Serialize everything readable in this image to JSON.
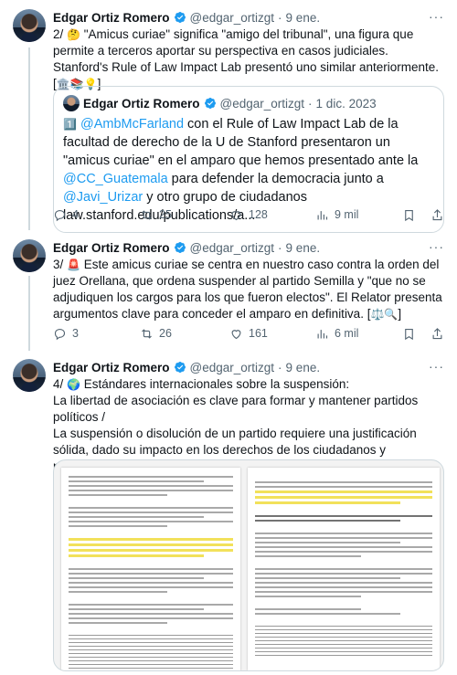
{
  "tweets": [
    {
      "author": "Edgar Ortiz Romero",
      "handle": "@edgar_ortizgt",
      "dot": "·",
      "date": "9 ene.",
      "more": "···",
      "text_prefix": "2/ ",
      "emoji_lead": "🤔",
      "text_body": " \"Amicus curiae\" significa \"amigo del tribunal\", una figura que permite a terceros aportar su perspectiva en casos judiciales. Stanford's Rule of Law Impact Lab presentó uno similar anteriormente. [",
      "emoji_trail": "🏛️📚💡",
      "text_close": "]",
      "quote": {
        "author": "Edgar Ortiz Romero",
        "handle": "@edgar_ortizgt",
        "dot": "·",
        "date": "1 dic. 2023",
        "emoji": "1️⃣",
        "mention1": "@AmbMcFarland",
        "t1": " con el Rule of Law Impact Lab de la facultad de derecho de la U de Stanford presentaron un \"amicus curiae\" en el amparo que hemos presentado ante la ",
        "mention2": "@CC_Guatemala",
        "t2": " para defender la democracia junto a ",
        "mention3": "@Javi_Urizar",
        "t3": " y otro grupo de ciudadanos law.stanford.edu/publications/a..."
      },
      "replies": "4",
      "retweets": "25",
      "likes": "128",
      "views": "9 mil"
    },
    {
      "author": "Edgar Ortiz Romero",
      "handle": "@edgar_ortizgt",
      "dot": "·",
      "date": "9 ene.",
      "more": "···",
      "text_prefix": "3/ ",
      "emoji_lead": "🚨",
      "text_body": " Este amicus curiae se centra en nuestro caso contra la orden del juez Orellana, que ordena suspender al partido Semilla y \"que no se adjudiquen los cargos para los que fueron electos\". El Relator presenta argumentos clave para conceder el amparo en definitiva. [",
      "emoji_trail": "⚖️🔍",
      "text_close": "]",
      "replies": "3",
      "retweets": "26",
      "likes": "161",
      "views": "6 mil"
    },
    {
      "author": "Edgar Ortiz Romero",
      "handle": "@edgar_ortizgt",
      "dot": "·",
      "date": "9 ene.",
      "more": "···",
      "text_prefix": "4/ ",
      "emoji_lead": "🌍",
      "text_body": " Estándares internacionales sobre la suspensión:",
      "line2": "La libertad de asociación es clave para formar y mantener partidos políticos /",
      "line3": "La suspensión o disolución de un partido requiere una justificación sólida, dado su impacto en los derechos de los ciudadanos y miembros."
    }
  ],
  "colors": {
    "text": "#0f1419",
    "secondary": "#536471",
    "link": "#1d9bf0",
    "border": "#cfd9de",
    "verified": "#1d9bf0",
    "highlight": "#f2e15a"
  },
  "icons": [
    "verified-badge-icon",
    "more-icon",
    "reply-icon",
    "retweet-icon",
    "like-icon",
    "views-icon",
    "bookmark-icon",
    "share-icon"
  ]
}
